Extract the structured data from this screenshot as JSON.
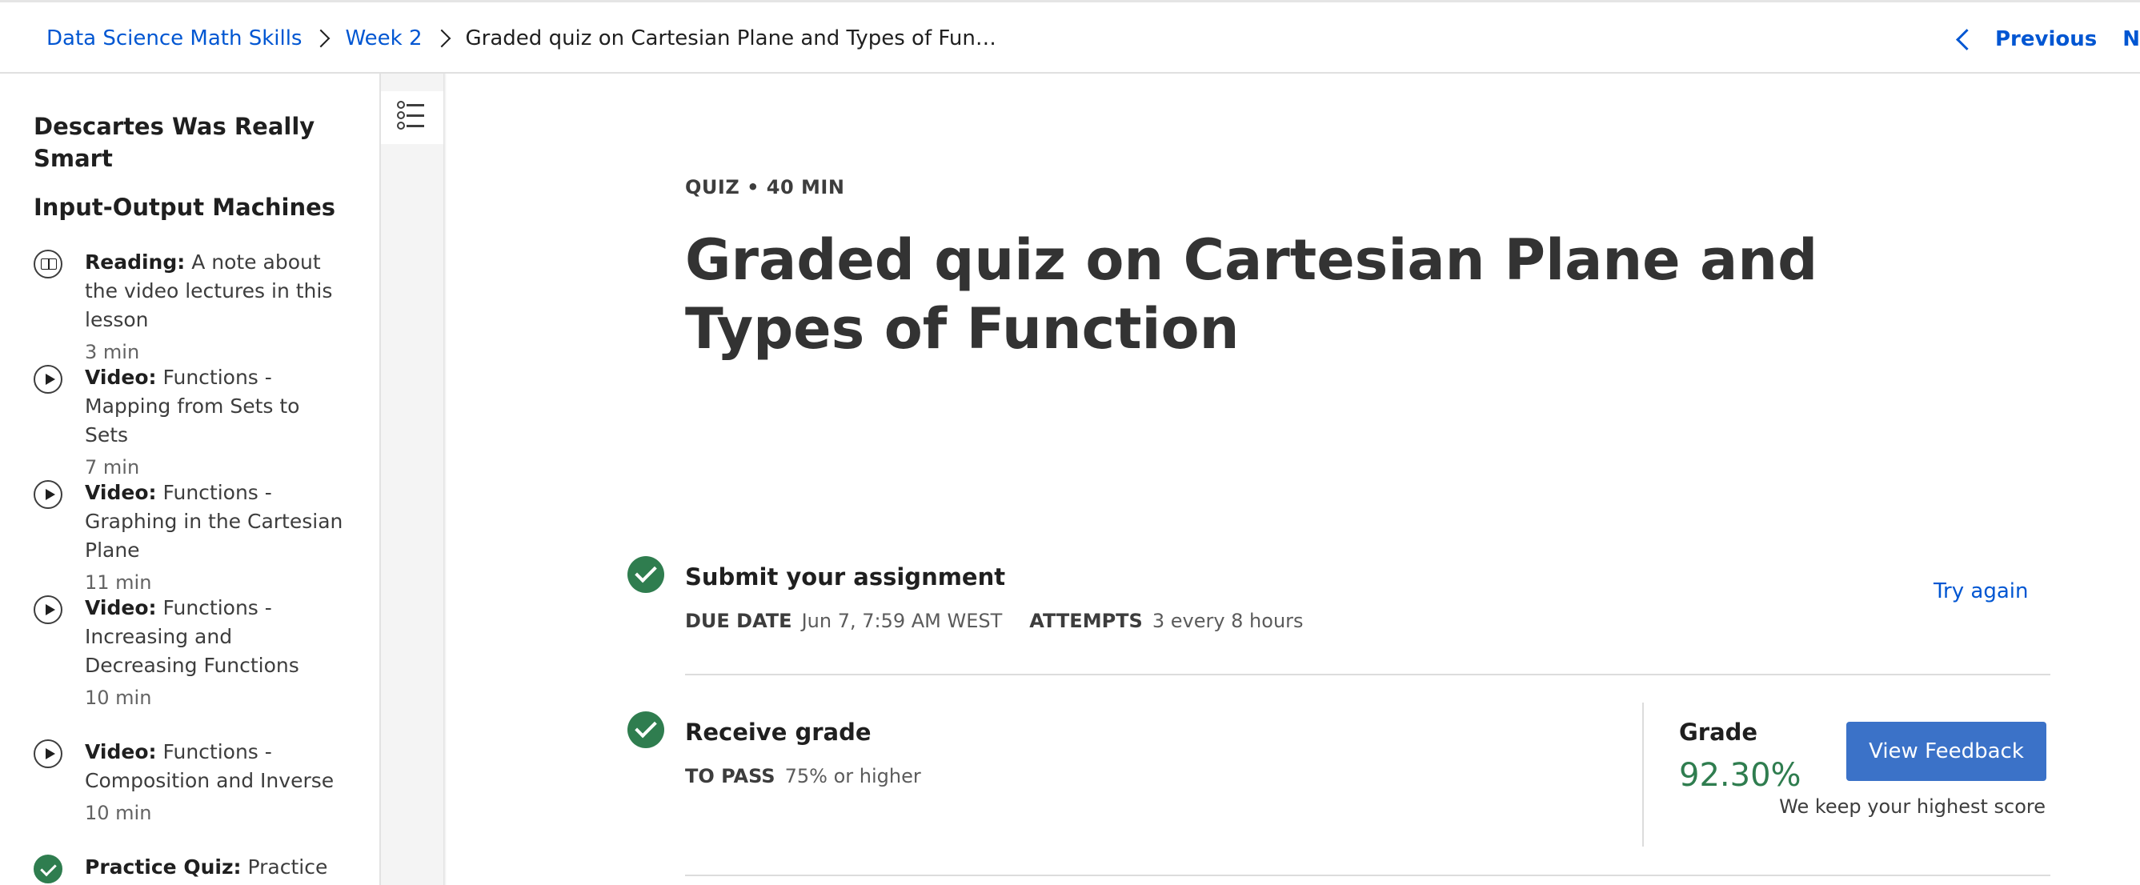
{
  "breadcrumb": {
    "items": [
      "Data Science Math Skills",
      "Week 2"
    ],
    "current": "Graded quiz on Cartesian Plane and Types of Fun…"
  },
  "nav": {
    "previous_label": "Previous",
    "next_label": "Nex"
  },
  "sidebar": {
    "module_title": "Descartes Was Really Smart",
    "lesson_title": "Input-Output Machines",
    "items": [
      {
        "kind": "Reading:",
        "title": "A note about the video lectures in this lesson",
        "duration": "3 min",
        "icon": "book-icon"
      },
      {
        "kind": "Video:",
        "title": "Functions - Mapping from Sets to Sets",
        "duration": "7 min",
        "icon": "play-icon"
      },
      {
        "kind": "Video:",
        "title": "Functions - Graphing in the Cartesian Plane",
        "duration": "11 min",
        "icon": "play-icon"
      },
      {
        "kind": "Video:",
        "title": "Functions - Increasing and Decreasing Functions",
        "duration": "10 min",
        "icon": "play-icon"
      },
      {
        "kind": "Video:",
        "title": "Functions - Composition and Inverse",
        "duration": "10 min",
        "icon": "play-icon"
      },
      {
        "kind": "Practice Quiz:",
        "title": "Practice quiz",
        "duration": "",
        "icon": "check-icon"
      }
    ]
  },
  "main": {
    "eyebrow": "QUIZ • 40 MIN",
    "title": "Graded quiz on Cartesian Plane and Types of Function",
    "submit": {
      "title": "Submit your assignment",
      "due_label": "DUE DATE",
      "due_value": "Jun 7, 7:59 AM WEST",
      "attempts_label": "ATTEMPTS",
      "attempts_value": "3 every 8 hours",
      "try_again_label": "Try again"
    },
    "grade": {
      "title": "Receive grade",
      "to_pass_label": "TO PASS",
      "to_pass_value": "75% or higher",
      "grade_label": "Grade",
      "grade_value": "92.30%",
      "feedback_button": "View Feedback",
      "note": "We keep your highest score"
    }
  },
  "colors": {
    "link": "#0056d2",
    "success": "#2f7d4f",
    "button": "#3b72c8"
  }
}
